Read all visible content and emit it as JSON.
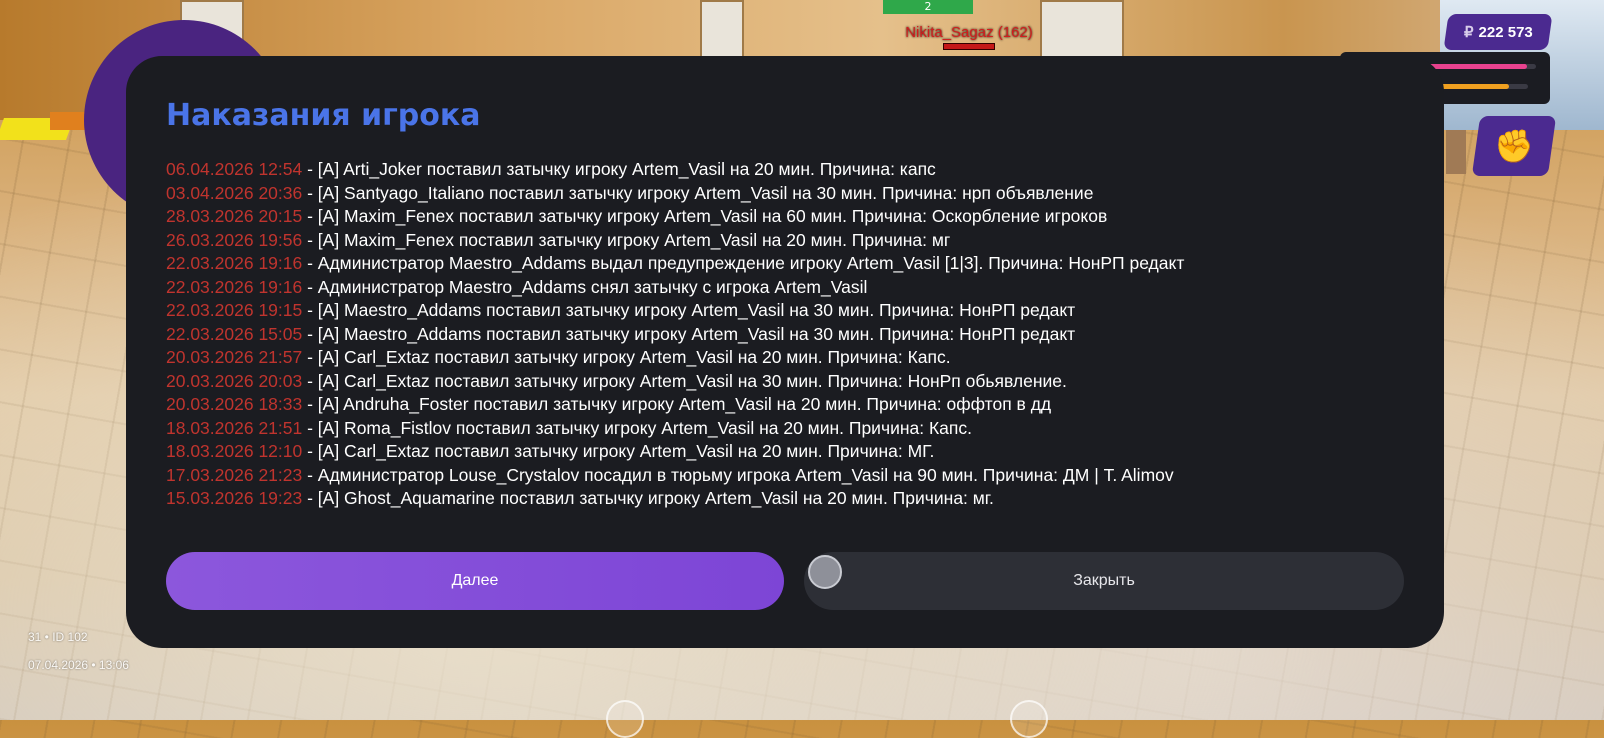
{
  "hud": {
    "player_name": "Nikita_Sagaz (162)",
    "money_symbol": "₽",
    "money": "222 573",
    "health_percent": 92,
    "armor_percent": 82,
    "weapon_icon": "fist-icon",
    "server_line": "31 • ID 102",
    "datetime_line": "07.04.2026 • 13:06"
  },
  "modal": {
    "title": "Наказания игрока",
    "entries": [
      {
        "date": "06.04.2026 12:54",
        "text": " - [A] Arti_Joker поставил затычку игроку Artem_Vasil на 20 мин. Причина: капс"
      },
      {
        "date": "03.04.2026 20:36",
        "text": " - [A] Santyago_Italiano поставил затычку игроку Artem_Vasil на 30 мин. Причина: нрп объявление"
      },
      {
        "date": "28.03.2026 20:15",
        "text": " - [A] Maxim_Fenex поставил затычку игроку Artem_Vasil на 60 мин. Причина: Оскорбление игроков"
      },
      {
        "date": "26.03.2026 19:56",
        "text": " - [A] Maxim_Fenex поставил затычку игроку Artem_Vasil на 20 мин. Причина: мг"
      },
      {
        "date": "22.03.2026 19:16",
        "text": " - Администратор Maestro_Addams выдал предупреждение игроку Artem_Vasil [1|3]. Причина: НонРП редакт"
      },
      {
        "date": "22.03.2026 19:16",
        "text": " - Администратор Maestro_Addams снял затычку с игрока Artem_Vasil"
      },
      {
        "date": "22.03.2026 19:15",
        "text": " - [A] Maestro_Addams поставил затычку игроку Artem_Vasil на 30 мин. Причина: НонРП редакт"
      },
      {
        "date": "22.03.2026 15:05",
        "text": " - [A] Maestro_Addams поставил затычку игроку Artem_Vasil на 30 мин. Причина: НонРП редакт"
      },
      {
        "date": "20.03.2026 21:57",
        "text": " - [A] Carl_Extaz поставил затычку игроку Artem_Vasil на 20 мин. Причина: Капс."
      },
      {
        "date": "20.03.2026 20:03",
        "text": " - [A] Carl_Extaz поставил затычку игроку Artem_Vasil на 30 мин. Причина: НонРп обьявление."
      },
      {
        "date": "20.03.2026 18:33",
        "text": " - [A] Andruha_Foster поставил затычку игроку Artem_Vasil на 20 мин. Причина: оффтоп в дд"
      },
      {
        "date": "18.03.2026 21:51",
        "text": " - [A] Roma_Fistlov поставил затычку игроку Artem_Vasil на 20 мин. Причина: Капс."
      },
      {
        "date": "18.03.2026 12:10",
        "text": " - [A] Carl_Extaz поставил затычку игроку Artem_Vasil на 20 мин. Причина: МГ."
      },
      {
        "date": "17.03.2026 21:23",
        "text": " - Администратор Louse_Crystalov посадил в тюрьму игрока Artem_Vasil на 90 мин. Причина: ДМ | T. Alimov"
      },
      {
        "date": "15.03.2026 19:23",
        "text": " - [A] Ghost_Aquamarine поставил затычку игроку Artem_Vasil на 20 мин. Причина: мг."
      }
    ],
    "next_label": "Далее",
    "close_label": "Закрыть"
  },
  "colors": {
    "title": "#4a74e8",
    "date": "#c0342e",
    "modal_bg": "#1b1c21",
    "accent_purple": "#8c57dc",
    "hud_purple": "#4b2a90"
  }
}
